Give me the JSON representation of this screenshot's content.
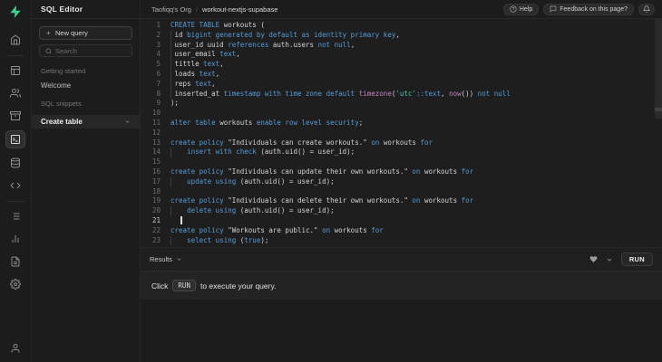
{
  "topbar": {
    "breadcrumbs": {
      "org": "Taofiqq's Org",
      "separator": "/",
      "project": "workout-nextjs-supabase"
    },
    "help_label": "Help",
    "feedback_label": "Feedback on this page?"
  },
  "sidebar": {
    "title": "SQL Editor",
    "new_query_label": "New query",
    "search_placeholder": "Search",
    "sections": [
      {
        "label": "Getting started",
        "items": [
          {
            "label": "Welcome",
            "active": false
          }
        ]
      },
      {
        "label": "SQL snippets",
        "items": [
          {
            "label": "Create table",
            "active": true
          }
        ]
      }
    ]
  },
  "icons": [
    "supabase-logo",
    "home-icon",
    "table-editor-icon",
    "auth-users-icon",
    "storage-icon",
    "sql-editor-icon",
    "database-icon",
    "api-code-icon",
    "logs-icon",
    "reports-icon",
    "docs-icon",
    "settings-icon",
    "account-icon",
    "help-icon",
    "feedback-icon",
    "notifications-bell-icon",
    "plus-icon",
    "search-icon",
    "chevron-down-icon",
    "favorite-heart-icon"
  ],
  "results": {
    "label": "Results",
    "run_label": "RUN"
  },
  "hint": {
    "pre": "Click",
    "kbd": "RUN",
    "post": "to execute your query."
  },
  "editor": {
    "token_colors": {
      "kw": "#569cd6",
      "pl": "#d4d4d4",
      "fn": "#c586c0",
      "str": "#4ec9b0"
    },
    "accent_green": "#3ecf8e",
    "lines": [
      {
        "n": 1,
        "tokens": [
          [
            "kw",
            "CREATE TABLE "
          ],
          [
            "pl",
            "workouts ("
          ]
        ]
      },
      {
        "n": 2,
        "guide": true,
        "tokens": [
          [
            "pl",
            " id "
          ],
          [
            "kw",
            "bigint generated by default as identity primary key"
          ],
          [
            "pl",
            ","
          ]
        ]
      },
      {
        "n": 3,
        "guide": true,
        "tokens": [
          [
            "pl",
            " user_id uuid "
          ],
          [
            "kw",
            "references "
          ],
          [
            "pl",
            "auth.users "
          ],
          [
            "kw",
            "not null"
          ],
          [
            "pl",
            ","
          ]
        ]
      },
      {
        "n": 4,
        "guide": true,
        "tokens": [
          [
            "pl",
            " user_email "
          ],
          [
            "kw",
            "text"
          ],
          [
            "pl",
            ","
          ]
        ]
      },
      {
        "n": 5,
        "guide": true,
        "tokens": [
          [
            "pl",
            " tittle "
          ],
          [
            "kw",
            "text"
          ],
          [
            "pl",
            ","
          ]
        ]
      },
      {
        "n": 6,
        "guide": true,
        "tokens": [
          [
            "pl",
            " loads "
          ],
          [
            "kw",
            "text"
          ],
          [
            "pl",
            ","
          ]
        ]
      },
      {
        "n": 7,
        "guide": true,
        "tokens": [
          [
            "pl",
            " reps "
          ],
          [
            "kw",
            "text"
          ],
          [
            "pl",
            ","
          ]
        ]
      },
      {
        "n": 8,
        "guide": true,
        "tokens": [
          [
            "pl",
            " inserted_at "
          ],
          [
            "kw",
            "timestamp with time zone default "
          ],
          [
            "fn",
            "timezone"
          ],
          [
            "pl",
            "("
          ],
          [
            "str",
            "'utc'"
          ],
          [
            "kw",
            "::text"
          ],
          [
            "pl",
            ", "
          ],
          [
            "fn",
            "now"
          ],
          [
            "pl",
            "()) "
          ],
          [
            "kw",
            "not null"
          ]
        ]
      },
      {
        "n": 9,
        "tokens": [
          [
            "pl",
            ");"
          ]
        ]
      },
      {
        "n": 10,
        "tokens": []
      },
      {
        "n": 11,
        "tokens": [
          [
            "kw",
            "alter table "
          ],
          [
            "pl",
            "workouts "
          ],
          [
            "kw",
            "enable row level security"
          ],
          [
            "pl",
            ";"
          ]
        ]
      },
      {
        "n": 12,
        "tokens": []
      },
      {
        "n": 13,
        "tokens": [
          [
            "kw",
            "create policy "
          ],
          [
            "pl",
            "\"Individuals can create workouts.\" "
          ],
          [
            "kw",
            "on "
          ],
          [
            "pl",
            "workouts "
          ],
          [
            "kw",
            "for"
          ]
        ]
      },
      {
        "n": 14,
        "guide": true,
        "tokens": [
          [
            "pl",
            "    "
          ],
          [
            "kw",
            "insert with check "
          ],
          [
            "pl",
            "(auth.uid() = user_id);"
          ]
        ]
      },
      {
        "n": 15,
        "tokens": []
      },
      {
        "n": 16,
        "tokens": [
          [
            "kw",
            "create policy "
          ],
          [
            "pl",
            "\"Individuals can update their own workouts.\" "
          ],
          [
            "kw",
            "on "
          ],
          [
            "pl",
            "workouts "
          ],
          [
            "kw",
            "for"
          ]
        ]
      },
      {
        "n": 17,
        "guide": true,
        "tokens": [
          [
            "pl",
            "    "
          ],
          [
            "kw",
            "update using "
          ],
          [
            "pl",
            "(auth.uid() = user_id);"
          ]
        ]
      },
      {
        "n": 18,
        "tokens": []
      },
      {
        "n": 19,
        "tokens": [
          [
            "kw",
            "create policy "
          ],
          [
            "pl",
            "\"Individuals can delete their own workouts.\" "
          ],
          [
            "kw",
            "on "
          ],
          [
            "pl",
            "workouts "
          ],
          [
            "kw",
            "for"
          ]
        ]
      },
      {
        "n": 20,
        "guide": true,
        "tokens": [
          [
            "pl",
            "    "
          ],
          [
            "kw",
            "delete using "
          ],
          [
            "pl",
            "(auth.uid() = user_id);"
          ]
        ]
      },
      {
        "n": 21,
        "current": true,
        "cursor": true,
        "tokens": []
      },
      {
        "n": 22,
        "tokens": [
          [
            "kw",
            "create policy "
          ],
          [
            "pl",
            "\"Workouts are public.\" "
          ],
          [
            "kw",
            "on "
          ],
          [
            "pl",
            "workouts "
          ],
          [
            "kw",
            "for"
          ]
        ]
      },
      {
        "n": 23,
        "guide": true,
        "tokens": [
          [
            "pl",
            "    "
          ],
          [
            "kw",
            "select using "
          ],
          [
            "pl",
            "("
          ],
          [
            "kw",
            "true"
          ],
          [
            "pl",
            ");"
          ]
        ]
      }
    ]
  }
}
